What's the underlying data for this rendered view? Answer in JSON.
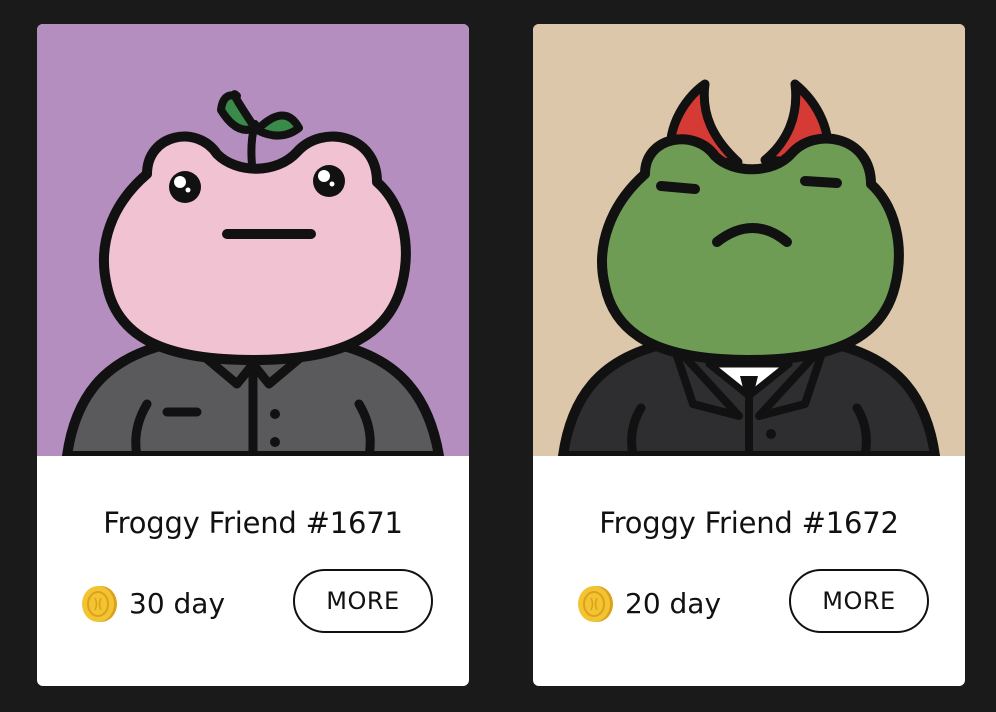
{
  "cards": [
    {
      "title": "Froggy Friend #1671",
      "duration": "30 day",
      "button_label": "MORE",
      "background": "#b48ebe",
      "frog_color": "#f1c2d2",
      "accessory": "sprout",
      "outfit": "grey-shirt"
    },
    {
      "title": "Froggy Friend #1672",
      "duration": "20 day",
      "button_label": "MORE",
      "background": "#dcc7aa",
      "frog_color": "#6e9c55",
      "accessory": "devil-horns",
      "outfit": "black-suit"
    }
  ],
  "colors": {
    "page_background": "#1a1a1a",
    "card_background": "#ffffff",
    "coin": "#f3c431"
  },
  "icons": {
    "coin": "gold-coin-icon"
  }
}
